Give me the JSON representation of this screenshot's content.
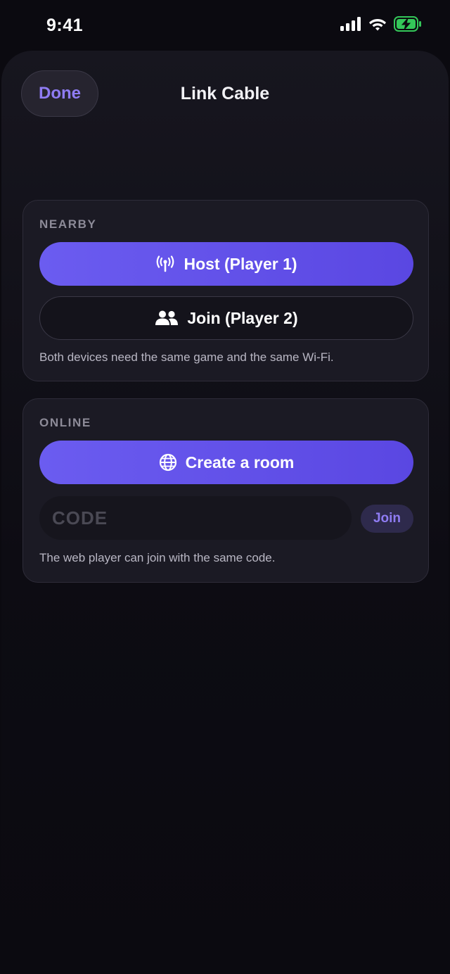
{
  "status_bar": {
    "time": "9:41",
    "icons": [
      "cellular-signal-icon",
      "wifi-icon",
      "battery-charging-icon"
    ]
  },
  "nav": {
    "done_label": "Done",
    "title": "Link Cable"
  },
  "nearby": {
    "section_label": "NEARBY",
    "host_label": "Host (Player 1)",
    "host_icon": "antenna-icon",
    "join_label": "Join (Player 2)",
    "join_icon": "people-icon",
    "hint": "Both devices need the same game and the same Wi-Fi."
  },
  "online": {
    "section_label": "ONLINE",
    "create_label": "Create a room",
    "create_icon": "globe-icon",
    "code_placeholder": "CODE",
    "code_value": "",
    "join_label": "Join",
    "hint": "The web player can join with the same code."
  },
  "colors": {
    "accent": "#6b5cf0",
    "accent_text": "#8f7cf3",
    "background": "#0b0a10",
    "card": "#1b1a24",
    "battery": "#34c759"
  }
}
